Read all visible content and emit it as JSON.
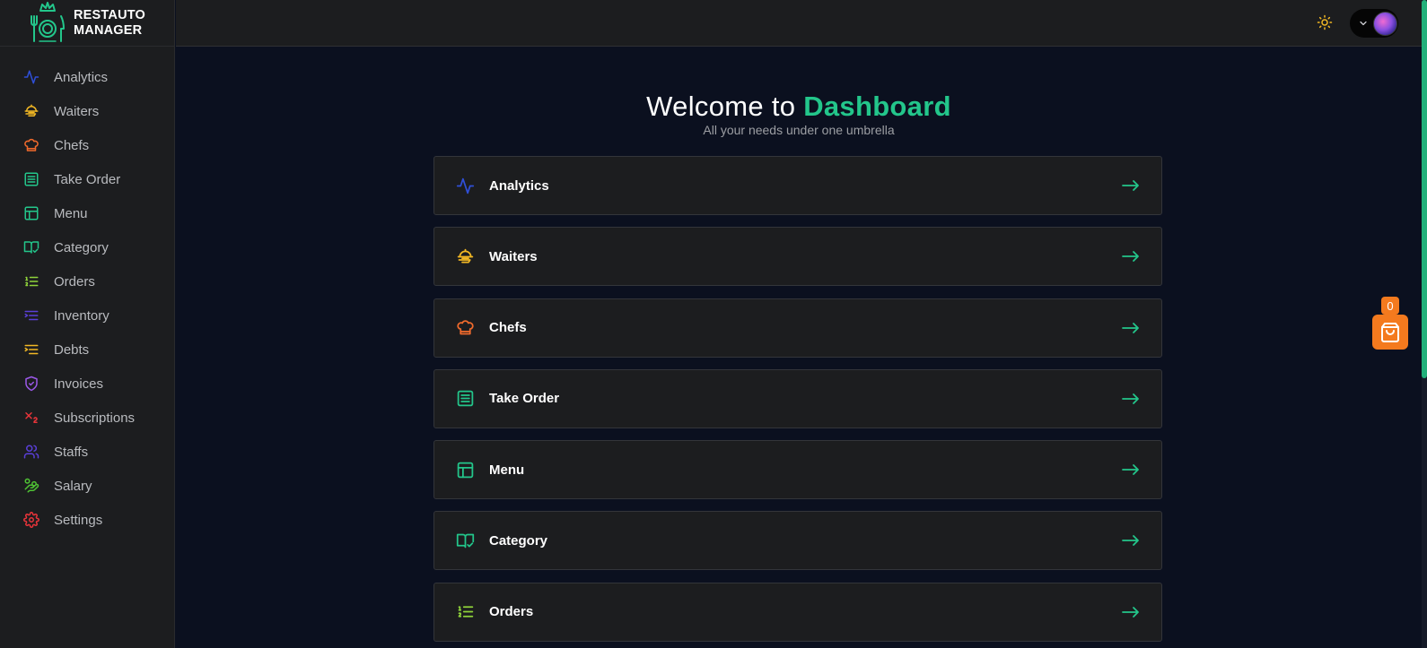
{
  "brand": {
    "line1": "RESTAUTO",
    "line2": "MANAGER"
  },
  "colors": {
    "accent": "#23c68b",
    "sidebar_bg": "#1c1d1f",
    "main_bg": "#0b101f",
    "cart_orange": "#f47a1e"
  },
  "sidebar": {
    "items": [
      {
        "label": "Analytics",
        "icon": "activity-icon",
        "color": "#2f4fd8"
      },
      {
        "label": "Waiters",
        "icon": "waiter-tray-icon",
        "color": "#f2b824"
      },
      {
        "label": "Chefs",
        "icon": "chef-hat-icon",
        "color": "#f06a2c"
      },
      {
        "label": "Take Order",
        "icon": "order-list-icon",
        "color": "#23c68b"
      },
      {
        "label": "Menu",
        "icon": "layout-icon",
        "color": "#23c68b"
      },
      {
        "label": "Category",
        "icon": "book-check-icon",
        "color": "#23c68b"
      },
      {
        "label": "Orders",
        "icon": "list-ordered-icon",
        "color": "#8fd33a"
      },
      {
        "label": "Inventory",
        "icon": "list-indent-icon",
        "color": "#5a3fd8"
      },
      {
        "label": "Debts",
        "icon": "list-indent-icon",
        "color": "#f2b824"
      },
      {
        "label": "Invoices",
        "icon": "shield-check-icon",
        "color": "#9b58e8"
      },
      {
        "label": "Subscriptions",
        "icon": "subscript-icon",
        "color": "#e8343a"
      },
      {
        "label": "Staffs",
        "icon": "users-icon",
        "color": "#5a3fd8"
      },
      {
        "label": "Salary",
        "icon": "hand-coins-icon",
        "color": "#4fc234"
      },
      {
        "label": "Settings",
        "icon": "gear-icon",
        "color": "#e8343a"
      }
    ]
  },
  "topbar": {
    "theme_icon": "sun-icon"
  },
  "main": {
    "welcome_prefix": "Welcome to ",
    "welcome_highlight": "Dashboard",
    "subtitle": "All your needs under one umbrella",
    "cards": [
      {
        "label": "Analytics",
        "icon": "activity-icon",
        "color": "#2f4fd8"
      },
      {
        "label": "Waiters",
        "icon": "waiter-tray-icon",
        "color": "#f2b824"
      },
      {
        "label": "Chefs",
        "icon": "chef-hat-icon",
        "color": "#f06a2c"
      },
      {
        "label": "Take Order",
        "icon": "order-list-icon",
        "color": "#23c68b"
      },
      {
        "label": "Menu",
        "icon": "layout-icon",
        "color": "#23c68b"
      },
      {
        "label": "Category",
        "icon": "book-check-icon",
        "color": "#23c68b"
      },
      {
        "label": "Orders",
        "icon": "list-ordered-icon",
        "color": "#8fd33a"
      }
    ]
  },
  "cart": {
    "count": "0"
  }
}
